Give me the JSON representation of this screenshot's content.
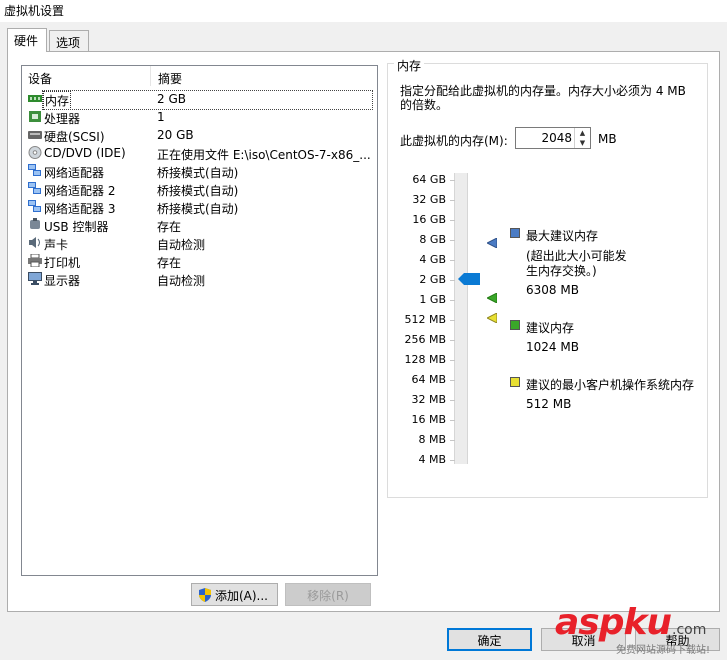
{
  "window": {
    "title": "虚拟机设置"
  },
  "tabs": [
    {
      "label": "硬件"
    },
    {
      "label": "选项"
    }
  ],
  "device_list": {
    "headers": {
      "device": "设备",
      "summary": "摘要"
    },
    "rows": [
      {
        "name": "内存",
        "summary": "2 GB",
        "icon": "memory-icon"
      },
      {
        "name": "处理器",
        "summary": "1",
        "icon": "processor-icon"
      },
      {
        "name": "硬盘(SCSI)",
        "summary": "20 GB",
        "icon": "hard-disk-icon"
      },
      {
        "name": "CD/DVD (IDE)",
        "summary": "正在使用文件 E:\\iso\\CentOS-7-x86_...",
        "icon": "cd-dvd-icon"
      },
      {
        "name": "网络适配器",
        "summary": "桥接模式(自动)",
        "icon": "network-adapter-icon"
      },
      {
        "name": "网络适配器 2",
        "summary": "桥接模式(自动)",
        "icon": "network-adapter-icon"
      },
      {
        "name": "网络适配器 3",
        "summary": "桥接模式(自动)",
        "icon": "network-adapter-icon"
      },
      {
        "name": "USB 控制器",
        "summary": "存在",
        "icon": "usb-icon"
      },
      {
        "name": "声卡",
        "summary": "自动检测",
        "icon": "sound-card-icon"
      },
      {
        "name": "打印机",
        "summary": "存在",
        "icon": "printer-icon"
      },
      {
        "name": "显示器",
        "summary": "自动检测",
        "icon": "display-icon"
      }
    ],
    "add_button": "添加(A)...",
    "remove_button": "移除(R)"
  },
  "memory": {
    "group_title": "内存",
    "description": "指定分配给此虚拟机的内存量。内存大小必须为 4 MB 的倍数。",
    "amount_label": "此虚拟机的内存(M):",
    "amount_value": "2048",
    "unit": "MB",
    "scale_labels": [
      "64 GB",
      "32 GB",
      "16 GB",
      "8 GB",
      "4 GB",
      "2 GB",
      "1 GB",
      "512 MB",
      "256 MB",
      "128 MB",
      "64 MB",
      "32 MB",
      "16 MB",
      "8 MB",
      "4 MB"
    ],
    "current_value": "2 GB",
    "legend": {
      "max_recommended_title": "最大建议内存",
      "max_recommended_note": "(超出此大小可能发生内存交换。)",
      "max_recommended_value": "6308 MB",
      "recommended_title": "建议内存",
      "recommended_value": "1024 MB",
      "min_guest_title": "建议的最小客户机操作系统内存",
      "min_guest_value": "512 MB"
    },
    "colors": {
      "max": "#4a7bc4",
      "recommended": "#3aa629",
      "min": "#e8e033",
      "thumb": "#0a7ad4"
    }
  },
  "footer": {
    "ok_button": "确定",
    "cancel_button": "取消",
    "help_button": "帮助"
  },
  "watermark": {
    "brand": "aspku",
    "com": ".com",
    "tagline": "免费网站源码下载站!"
  }
}
